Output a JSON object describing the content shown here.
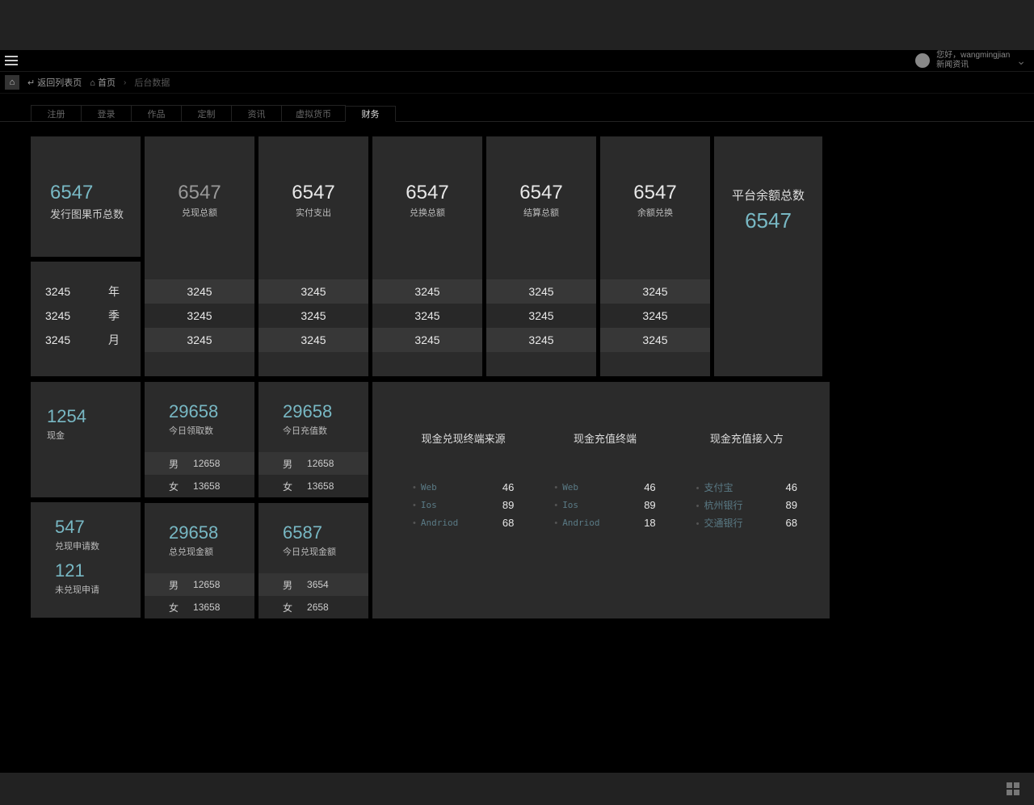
{
  "header": {
    "greeting": "您好，wangmingjian",
    "subtitle": "新闻资讯"
  },
  "breadcrumb": {
    "back": "返回列表页",
    "home": "首页",
    "current": "后台数据"
  },
  "tabs": [
    {
      "label": "注册"
    },
    {
      "label": "登录"
    },
    {
      "label": "作品"
    },
    {
      "label": "定制"
    },
    {
      "label": "资讯"
    },
    {
      "label": "虚拟货币"
    },
    {
      "label": "财务"
    }
  ],
  "active_tab": 6,
  "top": {
    "first": {
      "value": "6547",
      "label": "发行图果币总数"
    },
    "cols": [
      {
        "value": "6547",
        "label": "兑现总额",
        "rows": [
          "3245",
          "3245",
          "3245"
        ]
      },
      {
        "value": "6547",
        "label": "实付支出",
        "rows": [
          "3245",
          "3245",
          "3245"
        ]
      },
      {
        "value": "6547",
        "label": "兑换总额",
        "rows": [
          "3245",
          "3245",
          "3245"
        ]
      },
      {
        "value": "6547",
        "label": "结算总额",
        "rows": [
          "3245",
          "3245",
          "3245"
        ]
      },
      {
        "value": "6547",
        "label": "余额兑换",
        "rows": [
          "3245",
          "3245",
          "3245"
        ]
      }
    ],
    "balance": {
      "label": "平台余额总数",
      "value": "6547"
    },
    "periods": [
      {
        "num": "3245",
        "unit": "年"
      },
      {
        "num": "3245",
        "unit": "季"
      },
      {
        "num": "3245",
        "unit": "月"
      }
    ]
  },
  "mid": {
    "cash": {
      "value": "1254",
      "label": "现金"
    },
    "req": [
      {
        "value": "547",
        "label": "兑现申请数"
      },
      {
        "value": "121",
        "label": "未兑现申请"
      }
    ],
    "stats_row1": [
      {
        "value": "29658",
        "label": "今日领取数",
        "m": "12658",
        "f": "13658"
      },
      {
        "value": "29658",
        "label": "今日充值数",
        "m": "12658",
        "f": "13658"
      }
    ],
    "stats_row2": [
      {
        "value": "29658",
        "label": "总兑现金额",
        "m": "12658",
        "f": "13658"
      },
      {
        "value": "6587",
        "label": "今日兑现金额",
        "m": "3654",
        "f": "2658"
      }
    ],
    "gender": {
      "m": "男",
      "f": "女"
    }
  },
  "panel": {
    "cols": [
      {
        "title": "现金兑现终端来源",
        "items": [
          {
            "name": "Web",
            "val": "46"
          },
          {
            "name": "Ios",
            "val": "89"
          },
          {
            "name": "Andriod",
            "val": "68"
          }
        ]
      },
      {
        "title": "现金充值终端",
        "items": [
          {
            "name": "Web",
            "val": "46"
          },
          {
            "name": "Ios",
            "val": "89"
          },
          {
            "name": "Andriod",
            "val": "18"
          }
        ]
      },
      {
        "title": "现金充值接入方",
        "cn": true,
        "items": [
          {
            "name": "支付宝",
            "val": "46"
          },
          {
            "name": "杭州银行",
            "val": "89"
          },
          {
            "name": "交通银行",
            "val": "68"
          }
        ]
      }
    ]
  }
}
